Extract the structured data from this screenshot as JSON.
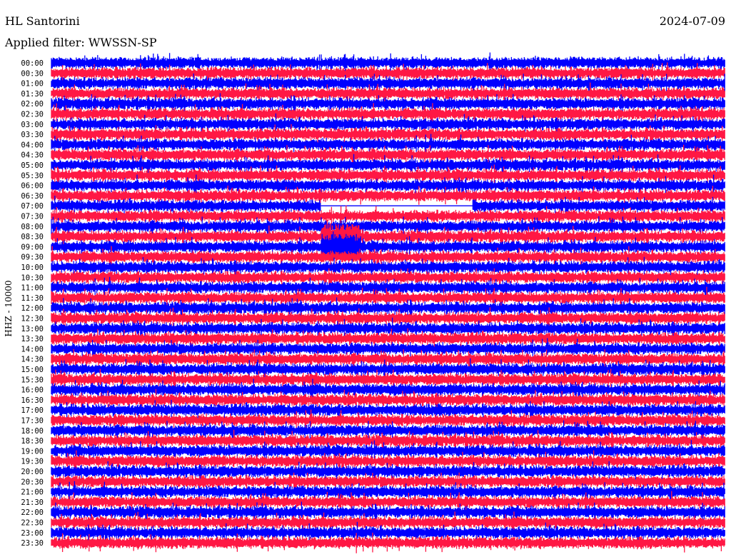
{
  "header": {
    "station": "HL Santorini",
    "date": "2024-07-09",
    "filter": "Applied filter: WWSSN-SP"
  },
  "chart_data": {
    "type": "line",
    "title": "HL Santorini",
    "date": "2024-07-09",
    "filter": "Applied filter: WWSSN-SP",
    "ylabel": "HHZ - 10000",
    "y_tick_labels": [
      "00:00",
      "00:30",
      "01:00",
      "01:30",
      "02:00",
      "02:30",
      "03:00",
      "03:30",
      "04:00",
      "04:30",
      "05:00",
      "05:30",
      "06:00",
      "06:30",
      "07:00",
      "07:30",
      "08:00",
      "08:30",
      "09:00",
      "09:30",
      "10:00",
      "10:30",
      "11:00",
      "11:30",
      "12:00",
      "12:30",
      "13:00",
      "13:30",
      "14:00",
      "14:30",
      "15:00",
      "15:30",
      "16:00",
      "16:30",
      "17:00",
      "17:30",
      "18:00",
      "18:30",
      "19:00",
      "19:30",
      "20:00",
      "20:30",
      "21:00",
      "21:30",
      "22:00",
      "22:30",
      "23:00",
      "23:30"
    ],
    "row_interval_minutes": 30,
    "colors": [
      "#0000ff",
      "#ff1744"
    ],
    "gaps": [
      {
        "row_label": "07:00",
        "start_fraction": 0.4,
        "end_fraction": 0.625
      }
    ],
    "events": [
      {
        "row_label": "08:30",
        "at_fraction": 0.43
      },
      {
        "row_label": "09:00",
        "at_fraction": 0.43
      }
    ]
  }
}
